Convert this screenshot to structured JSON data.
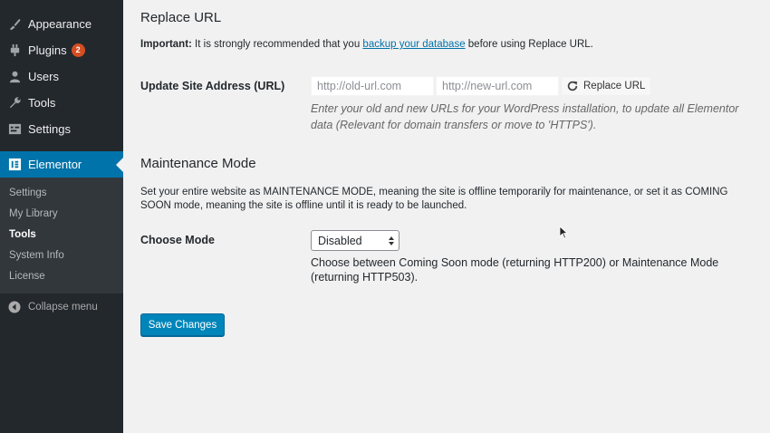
{
  "sidebar": {
    "items": [
      {
        "label": "Appearance",
        "icon": "paintbrush-icon"
      },
      {
        "label": "Plugins",
        "icon": "plugin-icon",
        "badge": "2"
      },
      {
        "label": "Users",
        "icon": "user-icon"
      },
      {
        "label": "Tools",
        "icon": "wrench-icon"
      },
      {
        "label": "Settings",
        "icon": "settings-icon"
      },
      {
        "label": "Elementor",
        "icon": "elementor-icon",
        "current": true
      }
    ],
    "submenu": [
      {
        "label": "Settings"
      },
      {
        "label": "My Library"
      },
      {
        "label": "Tools",
        "active": true
      },
      {
        "label": "System Info"
      },
      {
        "label": "License"
      }
    ],
    "collapse_label": "Collapse menu"
  },
  "replace_url": {
    "heading": "Replace URL",
    "notice_strong": "Important:",
    "notice_pre": " It is strongly recommended that you ",
    "notice_link": "backup your database",
    "notice_post": " before using Replace URL.",
    "row_label": "Update Site Address (URL)",
    "old_placeholder": "http://old-url.com",
    "new_placeholder": "http://new-url.com",
    "button_label": "Replace URL",
    "description_line1": "Enter your old and new URLs for your WordPress installation, to update all Elementor",
    "description_line2": "data (Relevant for domain transfers or move to 'HTTPS')."
  },
  "maintenance": {
    "heading": "Maintenance Mode",
    "intro_line1": "Set your entire website as MAINTENANCE MODE, meaning the site is offline temporarily for maintenance, or set it as COMING",
    "intro_line2": "SOON mode, meaning the site is offline until it is ready to be launched.",
    "row_label": "Choose Mode",
    "select_value": "Disabled",
    "description_line1": "Choose between Coming Soon mode (returning HTTP200) or Maintenance Mode",
    "description_line2": "(returning HTTP503)."
  },
  "save_label": "Save Changes",
  "colors": {
    "sidebar_bg": "#23282d",
    "submenu_bg": "#32373c",
    "accent": "#0073aa",
    "badge": "#d54e21",
    "primary_button": "#0085ba"
  }
}
